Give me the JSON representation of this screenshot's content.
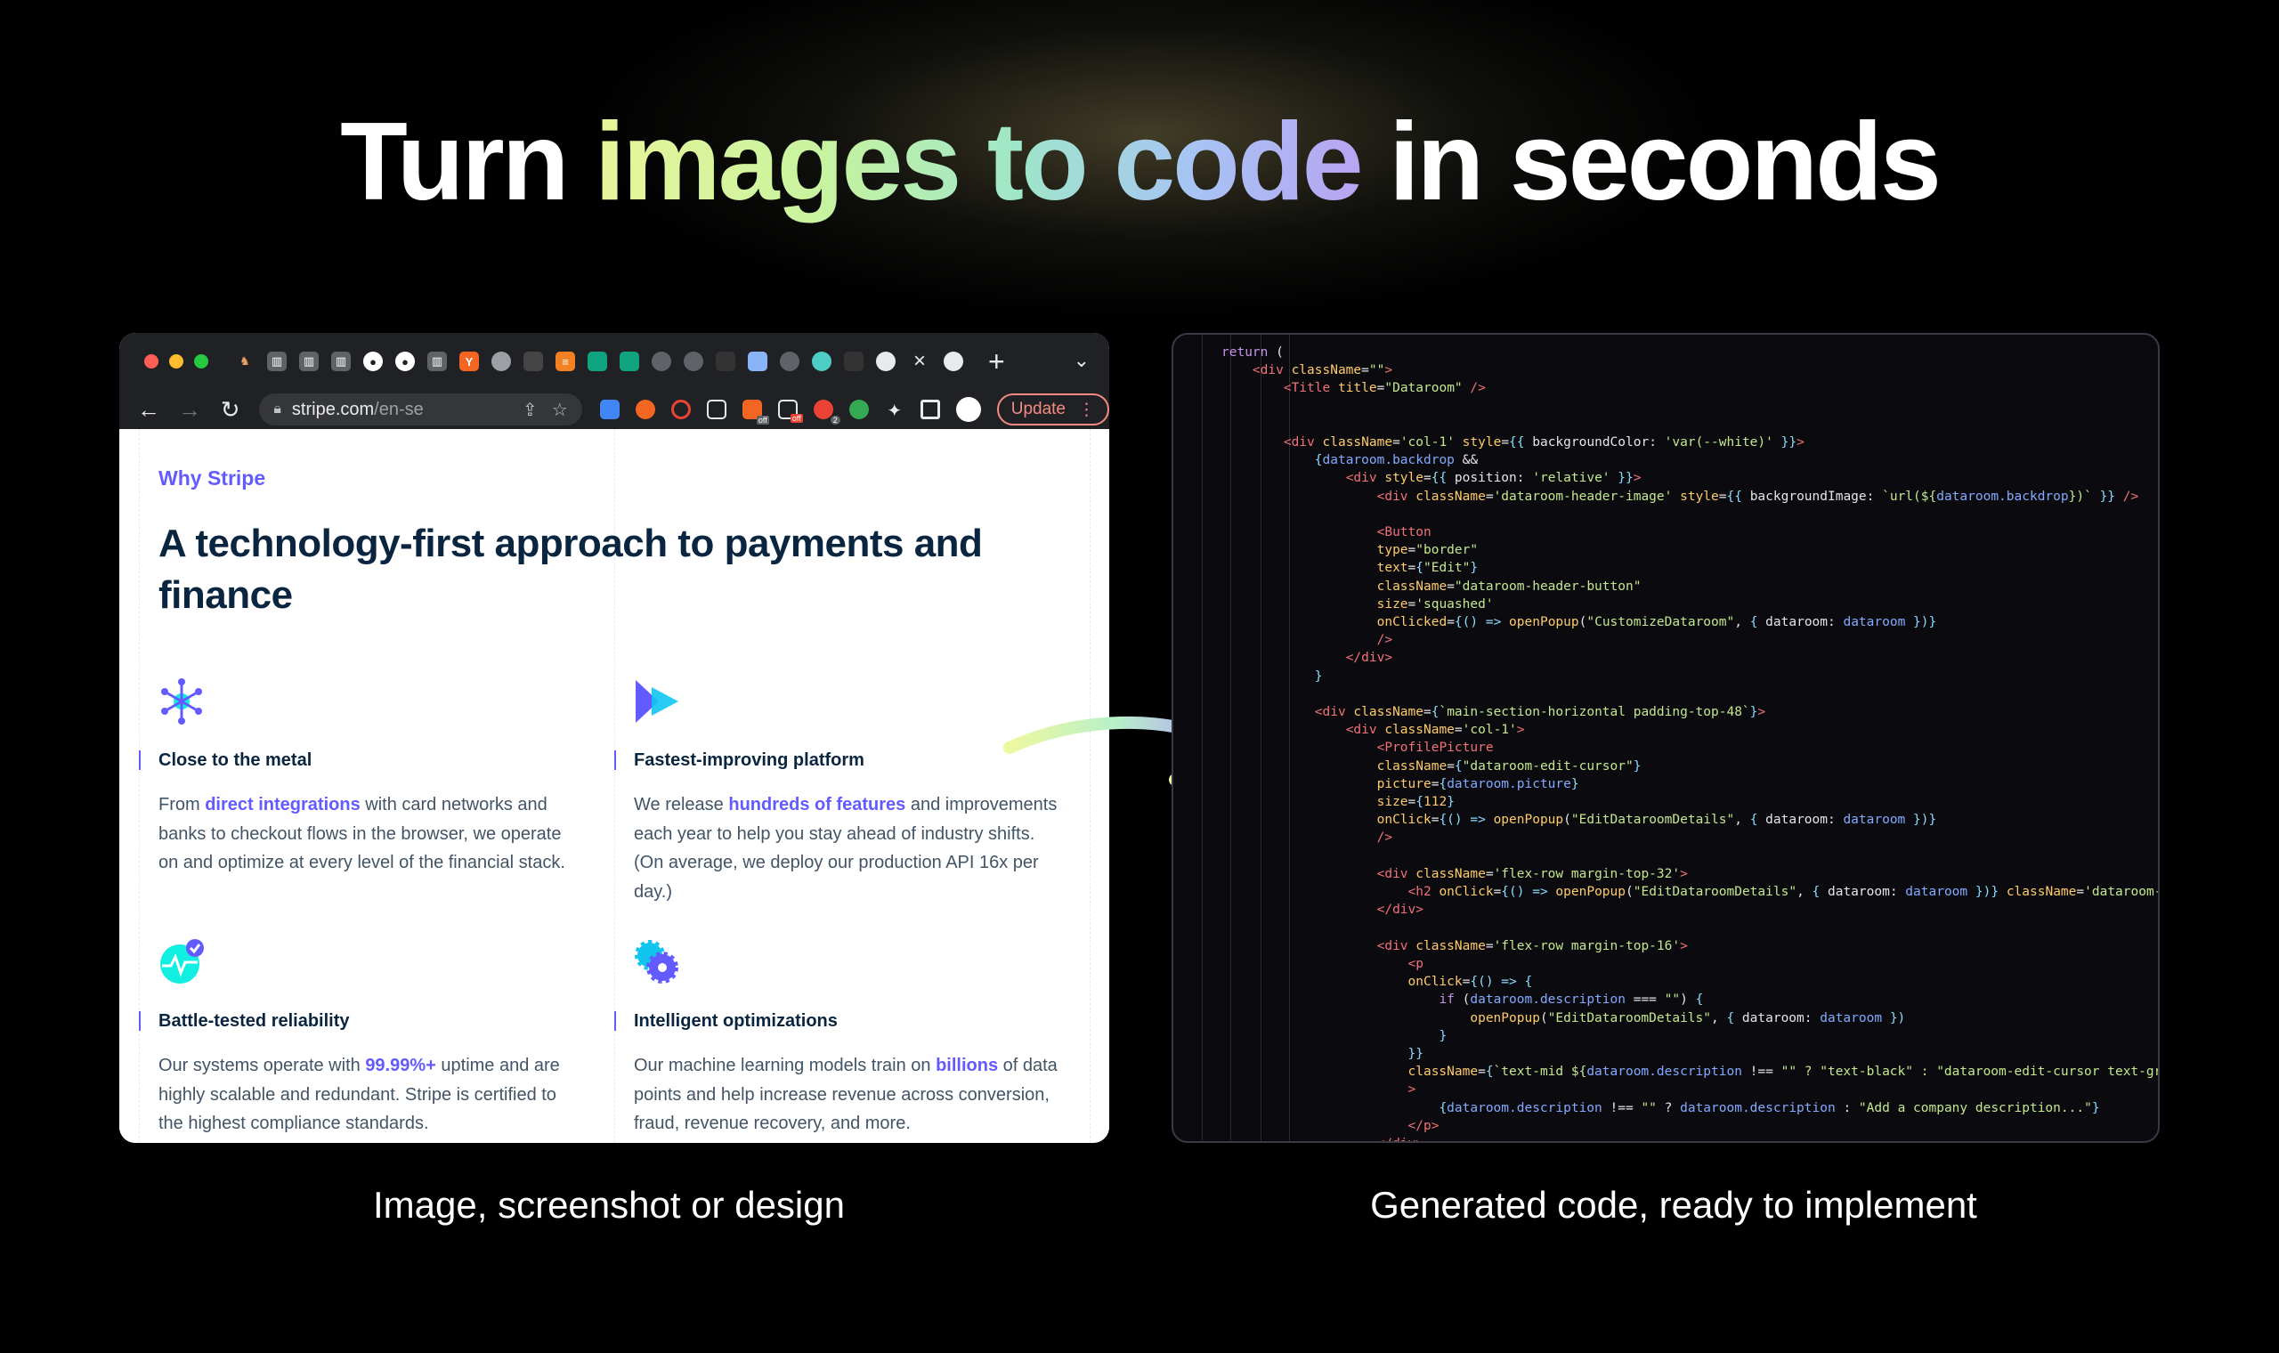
{
  "headline": {
    "part1": "Turn ",
    "highlight": "images to code",
    "part2": " in seconds"
  },
  "browser": {
    "url_host": "stripe.com",
    "url_path": "/en-se",
    "update_label": "Update",
    "ext_badges": [
      "off",
      "off",
      "2"
    ],
    "page": {
      "eyebrow": "Why Stripe",
      "title": "A technology-first approach to payments and finance",
      "features": [
        {
          "title": "Close to the metal",
          "body_pre": "From ",
          "link": "direct integrations",
          "body_post": " with card networks and banks to checkout flows in the browser, we operate on and optimize at every level of the financial stack."
        },
        {
          "title": "Fastest-improving platform",
          "body_pre": "We release ",
          "link": "hundreds of features",
          "body_post": " and improvements each year to help you stay ahead of industry shifts. (On average, we deploy our production API 16x per day.)"
        },
        {
          "title": "Battle-tested reliability",
          "body_pre": "Our systems operate with ",
          "link": "99.99%+",
          "body_post": " uptime and are highly scalable and redundant. Stripe is certified to the highest compliance standards."
        },
        {
          "title": "Intelligent optimizations",
          "body_pre": "Our machine learning models train on ",
          "link": "billions",
          "body_post": " of data points and help increase revenue across conversion, fraud, revenue recovery, and more."
        }
      ]
    }
  },
  "captions": {
    "left": "Image, screenshot or design",
    "right": "Generated code, ready to implement"
  },
  "colors": {
    "accent": "#635bff",
    "heading": "#0a2540",
    "body": "#425466"
  }
}
